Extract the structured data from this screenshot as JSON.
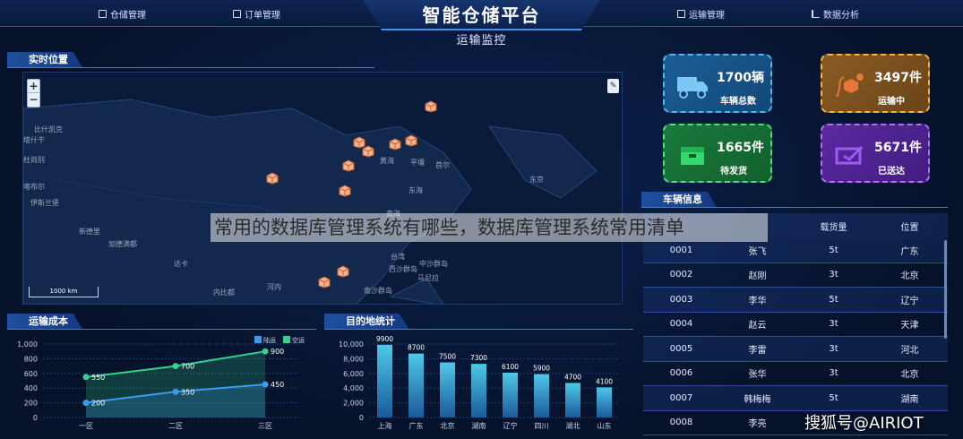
{
  "header": {
    "app_title": "智能仓储平台",
    "page_title": "运输监控",
    "nav": [
      "仓储管理",
      "订单管理",
      "运输管理",
      "数据分析"
    ]
  },
  "map_panel": {
    "title": "实时位置",
    "zoom_in": "+",
    "zoom_out": "−",
    "scale_label": "1000 km",
    "places": [
      "比什凯克",
      "塔什干",
      "杜尚别",
      "喀布尔",
      "伊斯兰堡",
      "新德里",
      "加德满都",
      "达卡",
      "内比都",
      "河内",
      "东京",
      "首尔",
      "平壤",
      "南海",
      "黄海",
      "东海",
      "台湾",
      "马尼拉",
      "西沙群岛",
      "南沙群岛",
      "中沙群岛"
    ]
  },
  "stats": [
    {
      "value": "1700辆",
      "label": "车辆总数",
      "icon": "truck-icon",
      "color": "#3aa0d8"
    },
    {
      "value": "3497件",
      "label": "运输中",
      "icon": "box-route-icon",
      "color": "#e0a030"
    },
    {
      "value": "1665件",
      "label": "待发货",
      "icon": "package-icon",
      "color": "#28c060"
    },
    {
      "value": "5671件",
      "label": "已送达",
      "icon": "delivered-icon",
      "color": "#8a40e0"
    }
  ],
  "vehicle_table": {
    "title": "车辆信息",
    "columns": [
      "载货量",
      "位置"
    ],
    "rows": [
      [
        "0001",
        "张飞",
        "5t",
        "广东"
      ],
      [
        "0002",
        "赵刚",
        "3t",
        "北京"
      ],
      [
        "0003",
        "李华",
        "5t",
        "辽宁"
      ],
      [
        "0004",
        "赵云",
        "3t",
        "天津"
      ],
      [
        "0005",
        "李雷",
        "3t",
        "河北"
      ],
      [
        "0006",
        "张华",
        "3t",
        "北京"
      ],
      [
        "0007",
        "韩梅梅",
        "5t",
        "湖南"
      ],
      [
        "0008",
        "李亮",
        "",
        ""
      ]
    ]
  },
  "cost_panel": {
    "title": "运输成本"
  },
  "dest_panel": {
    "title": "目的地统计"
  },
  "overlay_caption": "常用的数据库管理系统有哪些，数据库管理系统常用清单",
  "watermark": "搜狐号@AIRIOT",
  "chart_data": [
    {
      "type": "area",
      "title": "运输成本",
      "categories": [
        "一区",
        "二区",
        "三区"
      ],
      "ylim": [
        0,
        1000
      ],
      "yticks": [
        "0",
        "200",
        "400",
        "600",
        "800",
        "1,000"
      ],
      "legend_position": "top-right",
      "series": [
        {
          "name": "陆运",
          "values": [
            200,
            350,
            450
          ],
          "color": "#3a9cf0"
        },
        {
          "name": "空运",
          "values": [
            550,
            700,
            900
          ],
          "color": "#35d08a"
        }
      ]
    },
    {
      "type": "bar",
      "title": "目的地统计",
      "categories": [
        "上海",
        "广东",
        "北京",
        "湖南",
        "辽宁",
        "四川",
        "湖北",
        "山东"
      ],
      "values": [
        9900,
        8700,
        7500,
        7300,
        6100,
        5900,
        4700,
        4100
      ],
      "value_labels": [
        "9900",
        "8700",
        "7500",
        "7300",
        "6100",
        "5900",
        "4700",
        "4100"
      ],
      "ylim": [
        0,
        10000
      ],
      "yticks": [
        "0",
        "2,000",
        "4,000",
        "6,000",
        "8,000",
        "10,000"
      ]
    }
  ]
}
